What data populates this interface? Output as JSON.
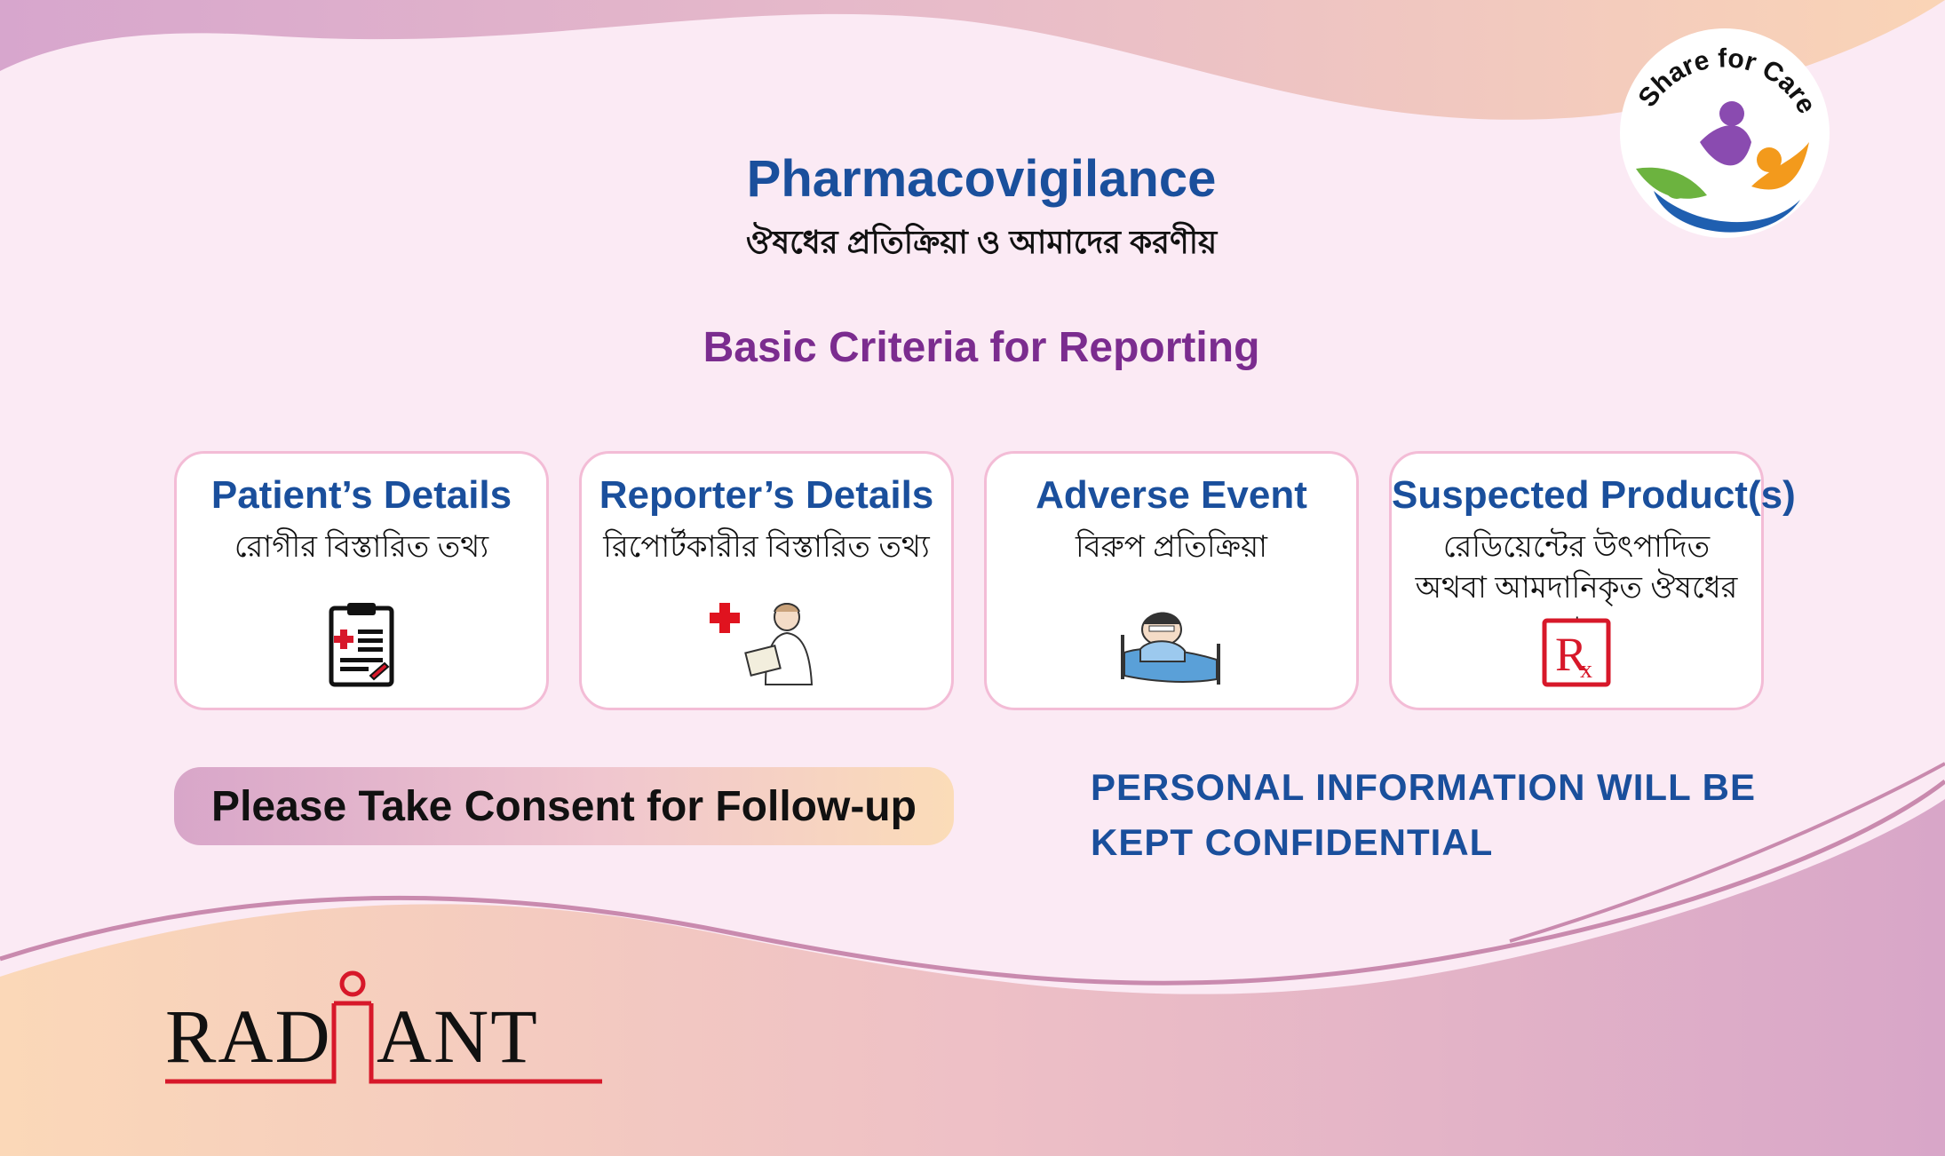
{
  "header": {
    "title": "Pharmacovigilance",
    "subtitle": "ঔষধের প্রতিক্রিয়া ও আমাদের করণীয়"
  },
  "criteria_heading": "Basic Criteria for Reporting",
  "cards": [
    {
      "title": "Patient’s Details",
      "subtitle": "রোগীর বিস্তারিত তথ্য",
      "icon": "clipboard-medical-icon"
    },
    {
      "title": "Reporter’s Details",
      "subtitle": "রিপোর্টকারীর বিস্তারিত তথ্য",
      "icon": "nurse-with-cross-icon"
    },
    {
      "title": "Adverse Event",
      "subtitle": "বিরুপ প্রতিক্রিয়া",
      "icon": "sick-patient-in-bed-icon"
    },
    {
      "title": "Suspected Product(s)",
      "subtitle": "রেডিয়েন্টের উৎপাদিত অথবা আমদানিকৃত ঔষধের নাম",
      "icon": "rx-prescription-icon"
    }
  ],
  "consent_banner": "Please Take Consent for Follow-up",
  "confidential_note": {
    "line1": "PERSONAL INFORMATION WILL BE",
    "line2": "KEPT CONFIDENTIAL"
  },
  "share_logo": {
    "text": "Share for Care",
    "icon": "share-for-care-logo"
  },
  "brand_logo": {
    "text": "RADIANT",
    "color": "#d7182a"
  },
  "colors": {
    "title_blue": "#1a4f9c",
    "heading_purple": "#7b2c8f",
    "card_border": "#f3bcd6",
    "background": "#fbeaf4",
    "brand_red": "#d7182a"
  }
}
